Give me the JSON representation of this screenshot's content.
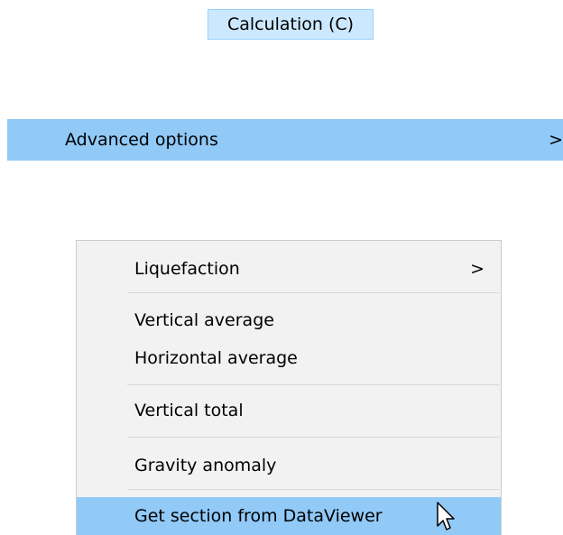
{
  "menu": {
    "header_label": "Calculation (C)",
    "advanced_label": "Advanced options",
    "advanced_arrow": ">"
  },
  "submenu": {
    "items": [
      {
        "label": "Liquefaction",
        "arrow": ">"
      },
      {
        "label": "Vertical average"
      },
      {
        "label": "Horizontal average"
      },
      {
        "label": "Vertical total"
      },
      {
        "label": "Gravity anomaly"
      },
      {
        "label": "Get section from DataViewer"
      }
    ]
  },
  "colors": {
    "highlight": "#91c9f7",
    "header_bg": "#cce8ff",
    "menu_bg": "#f2f2f2",
    "separator": "#d7d7d7"
  },
  "icons": {
    "cursor": "mouse-pointer-icon",
    "submenu_arrow": "chevron-right-icon"
  }
}
